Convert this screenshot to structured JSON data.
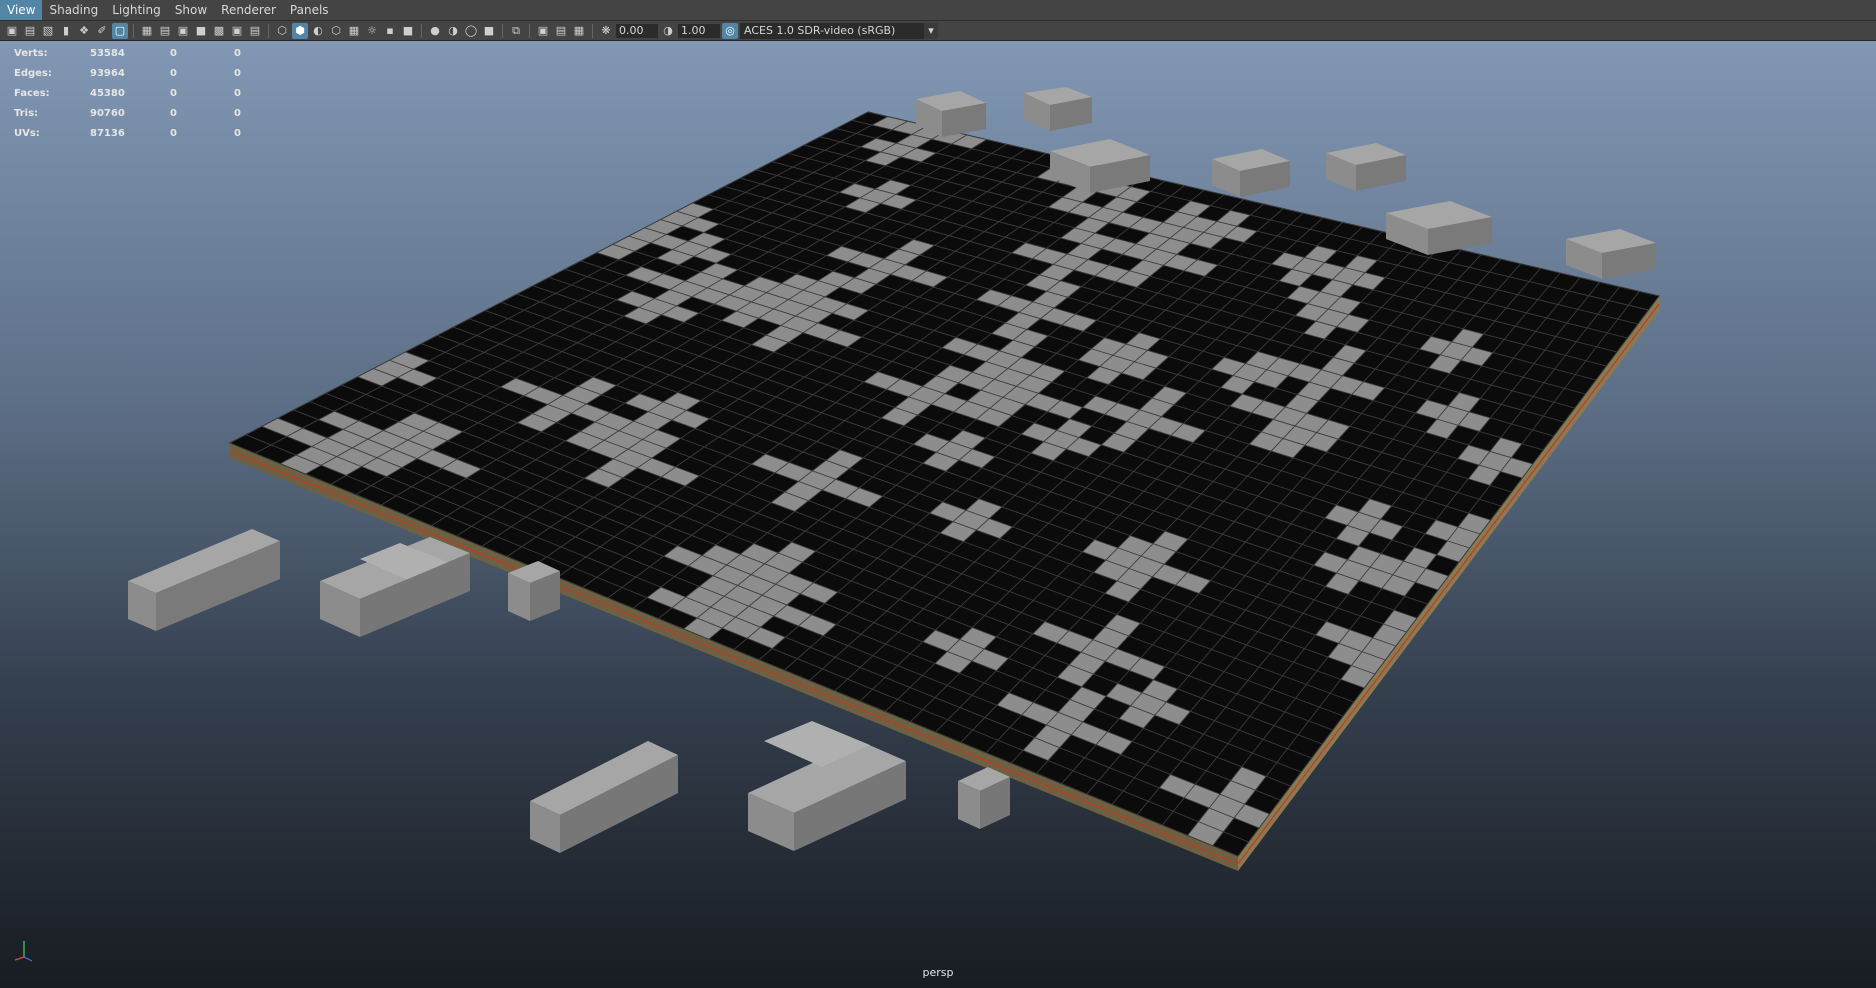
{
  "menu": {
    "items": [
      "View",
      "Shading",
      "Lighting",
      "Show",
      "Renderer",
      "Panels"
    ]
  },
  "toolbar": {
    "exposure": "0.00",
    "gamma": "1.00",
    "color_space": "ACES 1.0 SDR-video (sRGB)"
  },
  "hud": {
    "rows": [
      {
        "label": "Verts:",
        "value": "53584",
        "sel": "0",
        "sel2": "0"
      },
      {
        "label": "Edges:",
        "value": "93964",
        "sel": "0",
        "sel2": "0"
      },
      {
        "label": "Faces:",
        "value": "45380",
        "sel": "0",
        "sel2": "0"
      },
      {
        "label": "Tris:",
        "value": "90760",
        "sel": "0",
        "sel2": "0"
      },
      {
        "label": "UVs:",
        "value": "87136",
        "sel": "0",
        "sel2": "0"
      }
    ]
  },
  "viewport": {
    "camera": "persp",
    "axis_labels": {
      "x": "x",
      "y": "y"
    }
  },
  "colors": {
    "menu_bg": "#444444",
    "accent": "#5285a6",
    "plane_top": "#0b0b0b",
    "grid_line": "#3a3a3a",
    "tile": "#8a8a8a",
    "base_side": "#7a6a45",
    "edge_red": "#c0392b"
  },
  "icons": {
    "toolbar": [
      "camera-icon",
      "camera-attributes-icon",
      "bookmark-icon",
      "image-plane-icon",
      "grid-icon",
      "film-gate-icon",
      "resolution-gate-icon",
      "safe-action-icon",
      "wireframe-icon",
      "smooth-shade-icon",
      "default-material-icon",
      "xray-icon",
      "lights-icon",
      "shadows-icon",
      "isolate-select-icon",
      "exposure-icon",
      "gamma-icon",
      "color-management-icon"
    ]
  }
}
